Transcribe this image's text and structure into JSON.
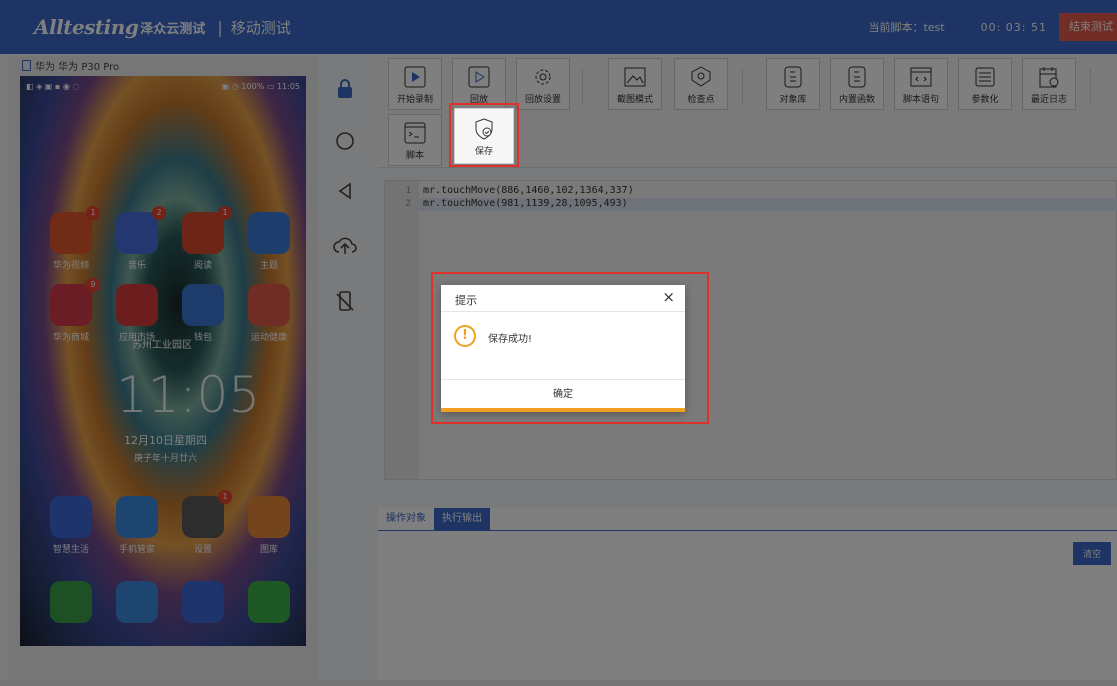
{
  "header": {
    "brand": "Alltesting",
    "brand_cn": "泽众云测试",
    "separator": "|",
    "module": "移动测试",
    "script_label": "当前脚本：test",
    "timer": "00:  03:  51",
    "end_button": "结束测试"
  },
  "device": {
    "title": "华为 华为 P30 Pro",
    "status_left": "◧ ◈ ▣ ▪ ◉ ◌",
    "status_right": "▣ ◷ 100% ▭ 11:05",
    "apps": [
      {
        "label": "华为视频",
        "badge": "1",
        "color": "#e0582c"
      },
      {
        "label": "音乐",
        "badge": "2",
        "color": "#4a6ee0"
      },
      {
        "label": "阅读",
        "badge": "1",
        "color": "#d84a2c"
      },
      {
        "label": "主题",
        "badge": "",
        "color": "#3a7ad8"
      },
      {
        "label": "华为商城",
        "badge": "9",
        "color": "#d63a4a"
      },
      {
        "label": "应用市场",
        "badge": "",
        "color": "#d83a3a"
      },
      {
        "label": "钱包",
        "badge": "",
        "color": "#3a78d8"
      },
      {
        "label": "运动健康",
        "badge": "",
        "color": "#e05a4a"
      },
      {
        "label": "智慧生活",
        "badge": "",
        "color": "#3a6ad8"
      },
      {
        "label": "手机管家",
        "badge": "",
        "color": "#3a8ae0"
      },
      {
        "label": "设置",
        "badge": "1",
        "color": "#5a5a5a"
      },
      {
        "label": "图库",
        "badge": "",
        "color": "#e88a3a"
      }
    ],
    "location": "苏州工业园区",
    "clock": "11:05",
    "date": "12月10日星期四",
    "lunar": "庚子年十月廿六"
  },
  "toolbar": {
    "row1": [
      {
        "label": "开始录制",
        "icon": "record-icon"
      },
      {
        "label": "回放",
        "icon": "play-icon"
      },
      {
        "label": "回放设置",
        "icon": "gear-icon"
      },
      {
        "label": "截图模式",
        "icon": "image-icon"
      },
      {
        "label": "检查点",
        "icon": "checkpoint-icon"
      },
      {
        "label": "对象库",
        "icon": "object-library-icon"
      },
      {
        "label": "内置函数",
        "icon": "function-icon"
      },
      {
        "label": "脚本语句",
        "icon": "code-icon"
      },
      {
        "label": "参数化",
        "icon": "parameter-icon"
      },
      {
        "label": "最近日志",
        "icon": "log-icon"
      }
    ],
    "row2": [
      {
        "label": "脚本",
        "icon": "terminal-icon"
      },
      {
        "label": "保存",
        "icon": "save-icon"
      }
    ]
  },
  "editor": {
    "lines": [
      {
        "num": "1",
        "code": "mr.touchMove(886,1460,102,1364,337)"
      },
      {
        "num": "2",
        "code": "mr.touchMove(981,1139,28,1095,493)"
      }
    ]
  },
  "output": {
    "tabs": [
      "操作对象",
      "执行输出"
    ],
    "clear": "清空"
  },
  "dialog": {
    "title": "提示",
    "close": "×",
    "icon": "!",
    "message": "保存成功!",
    "confirm": "确定"
  },
  "colors": {
    "primary": "#3a68c8",
    "danger": "#e45a4f",
    "warning": "#f0a020",
    "highlight": "#e0302a"
  }
}
